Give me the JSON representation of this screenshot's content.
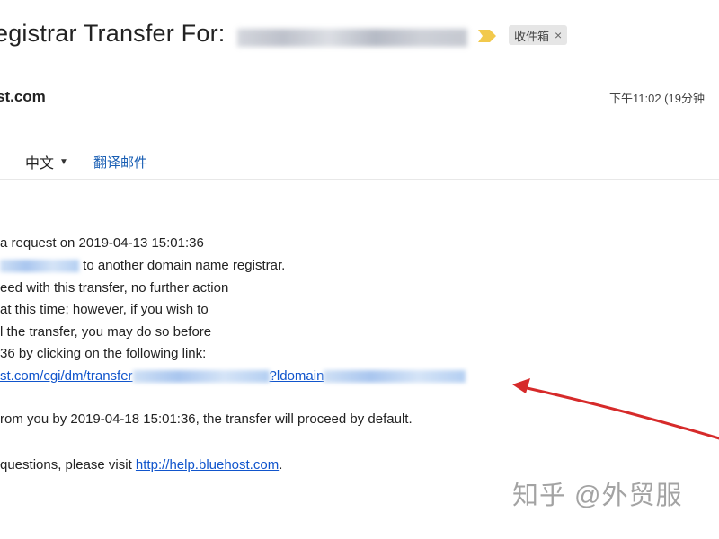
{
  "email": {
    "subject": "egistrar Transfer For:",
    "label_chip": "收件箱",
    "label_chip_close": "×",
    "sender": "st.com",
    "timestamp": "下午11:02 (19分钟",
    "toolbar": {
      "chevron": "›",
      "language": "中文",
      "language_caret": "▼",
      "translate": "翻译邮件"
    },
    "body": {
      "line1": "a request on 2019-04-13 15:01:36",
      "line2_suffix": " to another domain name registrar.",
      "line3": "eed with this transfer, no further action",
      "line4": "at this time; however, if you wish to",
      "line5": "l the transfer, you may do so before",
      "line6": "36 by clicking on the following link:",
      "link_part1": "st.com/cgi/dm/transfer",
      "link_part2": "?ldomain",
      "line8": "rom you by 2019-04-18 15:01:36, the transfer will proceed by default.",
      "line9_prefix": "questions, please visit ",
      "help_link": "http://help.bluehost.com",
      "line9_suffix": "."
    }
  },
  "watermark": "知乎 @外贸服",
  "annotation": {
    "arrow_color": "#d62a2a"
  },
  "colors": {
    "link": "#1155cc",
    "translate": "#1a5fb4"
  }
}
